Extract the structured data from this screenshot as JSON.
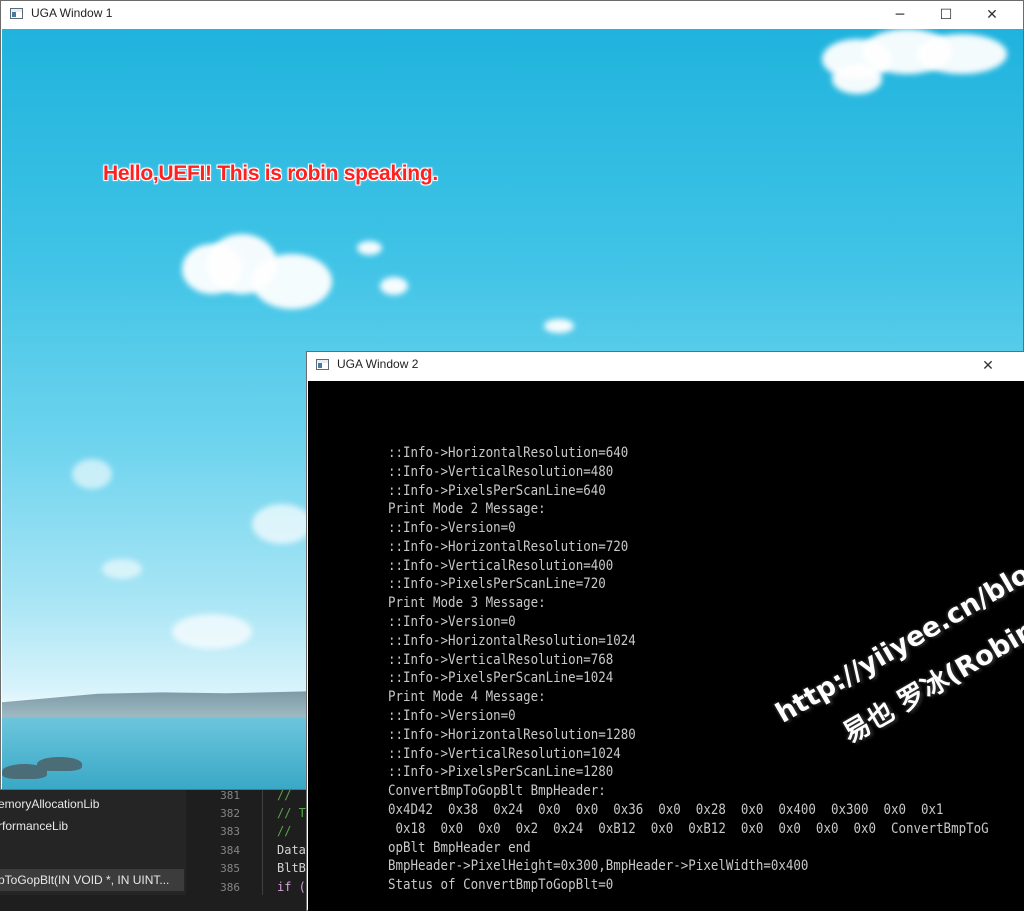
{
  "ide": {
    "sidebar_items": [
      "emoryAllocationLib",
      "rformanceLib",
      "pToGopBlt(IN VOID *, IN UINT..."
    ],
    "line_numbers": [
      "381",
      "382",
      "383",
      "384",
      "385",
      "386"
    ],
    "code_lines": [
      "//",
      "// T",
      "//",
      "Data",
      "BltB",
      "if ("
    ]
  },
  "window1": {
    "title": "UGA Window 1",
    "controls": {
      "minimize": "─",
      "maximize": "☐",
      "close": "✕"
    },
    "message": "Hello,UEFI!  This is robin speaking."
  },
  "window2": {
    "title": "UGA Window 2",
    "controls": {
      "close": "✕"
    },
    "console_lines": [
      "::Info->HorizontalResolution=640",
      "::Info->VerticalResolution=480",
      "::Info->PixelsPerScanLine=640",
      "Print Mode 2 Message:",
      "::Info->Version=0",
      "::Info->HorizontalResolution=720",
      "::Info->VerticalResolution=400",
      "::Info->PixelsPerScanLine=720",
      "Print Mode 3 Message:",
      "::Info->Version=0",
      "::Info->HorizontalResolution=1024",
      "::Info->VerticalResolution=768",
      "::Info->PixelsPerScanLine=1024",
      "Print Mode 4 Message:",
      "::Info->Version=0",
      "::Info->HorizontalResolution=1280",
      "::Info->VerticalResolution=1024",
      "::Info->PixelsPerScanLine=1280",
      "ConvertBmpToGopBlt BmpHeader:",
      "0x4D42  0x38  0x24  0x0  0x0  0x36  0x0  0x28  0x0  0x400  0x300  0x0  0x1",
      " 0x18  0x0  0x0  0x2  0x24  0xB12  0x0  0xB12  0x0  0x0  0x0  0x0  ConvertBmpToG",
      "opBlt BmpHeader end",
      "BmpHeader->PixelHeight=0x300,BmpHeader->PixelWidth=0x400",
      "Status of ConvertBmpToGopBlt=0"
    ]
  },
  "watermark": {
    "line1": "http://yiiyee.cn/blog/",
    "line2": "易也  罗冰(Robin)"
  }
}
